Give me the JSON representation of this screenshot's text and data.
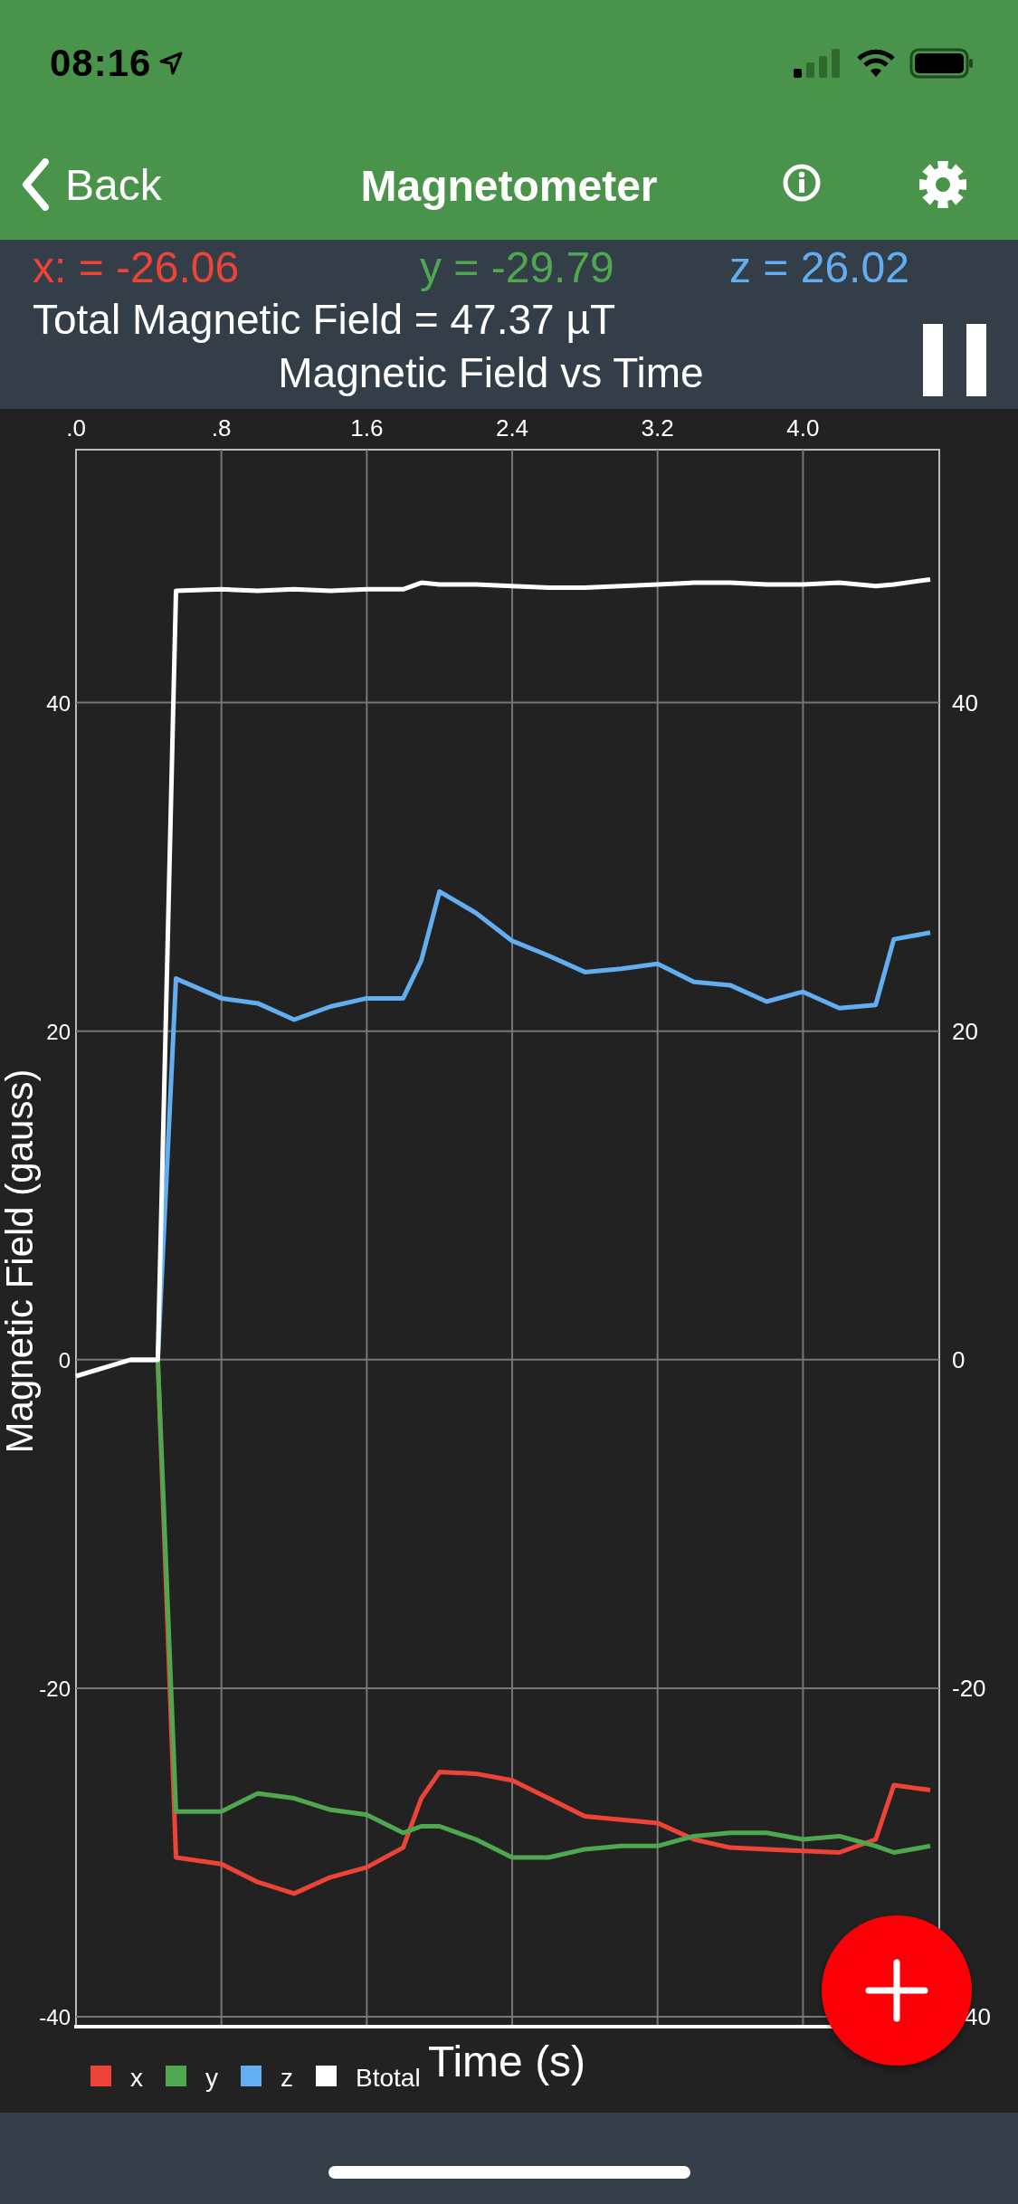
{
  "status_bar": {
    "time": "08:16"
  },
  "nav": {
    "back": "Back",
    "title": "Magnetometer"
  },
  "readings": [
    {
      "text": "x: = -26.06",
      "color": "#ee4438"
    },
    {
      "text": "y = -29.79",
      "color": "#4fa84f"
    },
    {
      "text": "z = 26.02",
      "color": "#62aef0"
    }
  ],
  "total": "Total Magnetic Field = 47.37 µT",
  "running": true,
  "chart": {
    "chart_data": {
      "type": "line",
      "title": "Magnetic Field vs Time",
      "xlabel": "Time (s)",
      "ylabel": "Magnetic Field (gauss)",
      "x": [
        0,
        0.3,
        0.45,
        0.55,
        0.8,
        1.0,
        1.2,
        1.4,
        1.6,
        1.8,
        1.9,
        2.0,
        2.2,
        2.4,
        2.6,
        2.8,
        3.0,
        3.2,
        3.4,
        3.6,
        3.8,
        4.0,
        4.2,
        4.4,
        4.5,
        4.7
      ],
      "series": [
        {
          "name": "x",
          "color": "#ee4438",
          "values": [
            null,
            0,
            0,
            -30.3,
            -30.7,
            -31.8,
            -32.5,
            -31.5,
            -30.9,
            -29.7,
            -26.7,
            -25.1,
            -25.2,
            -25.6,
            -26.7,
            -27.8,
            -28,
            -28.2,
            -29.2,
            -29.7,
            -29.8,
            -29.9,
            -30,
            -29.2,
            -25.9,
            -26.2
          ]
        },
        {
          "name": "y",
          "color": "#4fa84f",
          "values": [
            null,
            0,
            0,
            -27.5,
            -27.5,
            -26.4,
            -26.7,
            -27.4,
            -27.7,
            -28.8,
            -28.4,
            -28.4,
            -29.2,
            -30.3,
            -30.3,
            -29.8,
            -29.6,
            -29.6,
            -29,
            -28.8,
            -28.8,
            -29.2,
            -29,
            -29.6,
            -30,
            -29.6
          ]
        },
        {
          "name": "z",
          "color": "#62aef0",
          "values": [
            null,
            0,
            0,
            23.2,
            22,
            21.7,
            20.7,
            21.5,
            22,
            22,
            24.3,
            28.5,
            27.2,
            25.5,
            24.6,
            23.6,
            23.8,
            24.1,
            23,
            22.8,
            21.8,
            22.4,
            21.4,
            21.6,
            25.6,
            26
          ]
        },
        {
          "name": "Btotal",
          "color": "#ffffff",
          "values": [
            -1,
            0,
            0,
            46.8,
            46.9,
            46.8,
            46.9,
            46.8,
            46.9,
            46.9,
            47.3,
            47.2,
            47.2,
            47.1,
            47,
            47,
            47.1,
            47.2,
            47.3,
            47.3,
            47.2,
            47.2,
            47.3,
            47.1,
            47.2,
            47.5
          ]
        }
      ],
      "xlim": [
        0,
        4.75
      ],
      "ylim": [
        -40.6,
        55.4
      ],
      "xticks": [
        {
          "value": 0,
          "label": ".0"
        },
        {
          "value": 0.8,
          "label": ".8"
        },
        1.6,
        2.4,
        3.2,
        {
          "value": 4,
          "label": "4.0"
        }
      ],
      "yticks": [
        -40,
        -20,
        0,
        20,
        40
      ],
      "grid": true,
      "legend": "bottom-left"
    },
    "right_axis_labels": [
      "40",
      "20",
      "0",
      "-20",
      "40"
    ]
  }
}
